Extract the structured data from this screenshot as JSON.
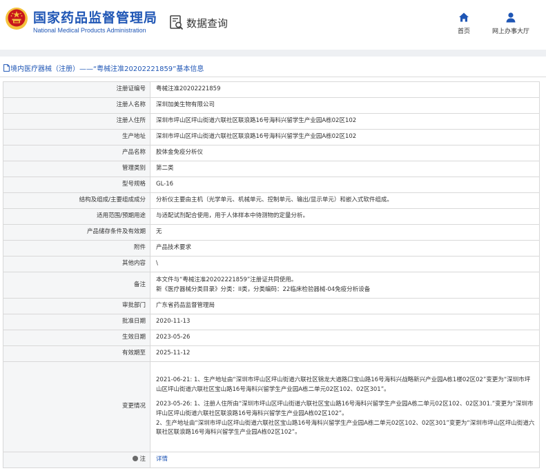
{
  "header": {
    "logo_cn": "国家药品监督管理局",
    "logo_en": "National Medical Products Administration",
    "section_title": "数据查询",
    "nav": [
      {
        "label": "首页",
        "icon": "home-icon"
      },
      {
        "label": "网上办事大厅",
        "icon": "user-icon"
      }
    ],
    "colors": {
      "brand": "#1f56b5",
      "emblem_red": "#c8161d",
      "emblem_gold": "#f4c23d"
    }
  },
  "title": "境内医疗器械（注册）——“粤械注准20202221859”基本信息",
  "rows": [
    {
      "label": "注册证编号",
      "value": "粤械注准20202221859"
    },
    {
      "label": "注册人名称",
      "value": "深圳加美生物有限公司"
    },
    {
      "label": "注册人住所",
      "value": "深圳市坪山区坪山街道六联社区联浪路16号海科兴留学生产业园A栋02区102"
    },
    {
      "label": "生产地址",
      "value": "深圳市坪山区坪山街道六联社区联浪路16号海科兴留学生产业园A栋02区102"
    },
    {
      "label": "产品名称",
      "value": "胶体金免疫分析仪"
    },
    {
      "label": "管理类别",
      "value": "第二类"
    },
    {
      "label": "型号规格",
      "value": "GL-16"
    },
    {
      "label": "结构及组成/主要组成成分",
      "value": "分析仪主要由主机（光学单元、机械单元、控制单元、输出/显示单元）和嵌入式软件组成。"
    },
    {
      "label": "适用范围/预期用途",
      "value": "与适配试剂配合使用，用于人体样本中待测物的定量分析。"
    },
    {
      "label": "产品储存条件及有效期",
      "value": "无"
    },
    {
      "label": "附件",
      "value": "产品技术要求"
    },
    {
      "label": "其他内容",
      "value": "\\"
    },
    {
      "label": "备注",
      "lines": [
        "本文件与“粤械注准20202221859”注册证共同使用。",
        "新《医疗器械分类目录》分类：II类，分类编码：22临床检验器械-04免疫分析设备"
      ]
    },
    {
      "label": "审批部门",
      "value": "广东省药品监督管理局"
    },
    {
      "label": "批准日期",
      "value": "2020-11-13"
    },
    {
      "label": "生效日期",
      "value": "2023-05-26"
    },
    {
      "label": "有效期至",
      "value": "2025-11-12"
    },
    {
      "label": "变更情况",
      "lines": [
        "2021-06-21: 1、生产地址由“深圳市坪山区坪山街道六联社区锦龙大道路口宝山路16号海科兴战略新兴产业园A栋1楼02区02”变更为“深圳市坪山区坪山街道六联社区宝山路16号海科兴留学生产业园A栋二单元02区102、02区301”。",
        "2023-05-26: 1、注册人住所由“深圳市坪山区坪山街道六联社区宝山路16号海科兴留学生产业园A栋二单元02区102、02区301.”变更为“深圳市坪山区坪山街道六联社区联浪路16号海科兴留学生产业园A栋02区102”。",
        "2、生产地址由“深圳市坪山区坪山街道六联社区宝山路16号海科兴留学生产业园A栋二单元02区102、02区301”变更为“深圳市坪山区坪山街道六联社区联浪路16号海科兴留学生产业园A栋02区102”。"
      ]
    },
    {
      "label": "注",
      "value": "详情"
    }
  ]
}
